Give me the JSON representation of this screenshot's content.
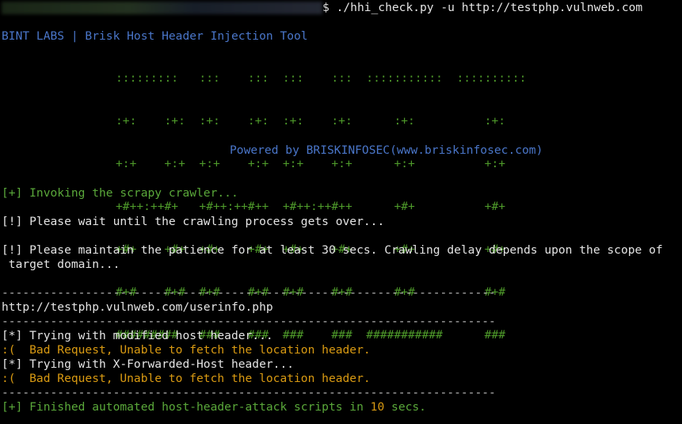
{
  "prompt": {
    "suffix": "$",
    "command": " ./hhi_check.py -u http://testphp.vulnweb.com"
  },
  "banner": {
    "title": "BINT LABS | Brisk Host Header Injection Tool",
    "ascii_art": [
      ":::::::::   :::    :::  :::    :::  :::::::::::  ::::::::::",
      ":+:    :+:  :+:    :+:  :+:    :+:      :+:          :+:",
      "+:+    +:+  +:+    +:+  +:+    +:+      +:+          +:+",
      "+#++:++#+   +#++:++#++  +#++:++#++      +#+          +#+",
      "+#+    +#+  +#+    +#+  +#+    +#+      +#+          +#+",
      "#+#    #+#  #+#    #+#  #+#    #+#      #+#          #+#",
      "#########   ###    ###  ###    ###  ###########      ###"
    ],
    "powered_by": "Powered by BRISKINFOSEC(www.briskinfosec.com)"
  },
  "output": {
    "invoking": "[+] Invoking the scrapy crawler...",
    "wait": "[!] Please wait until the crawling process gets over...",
    "patience_1": "[!] Please maintain the patience for at least 30 secs. Crawling delay depends upon the scope of",
    "patience_2": " target domain...",
    "separator": "-----------------------------------------------------------------------",
    "url": "http://testphp.vulnweb.com/userinfo.php",
    "try_host": "[*] Trying with modified host header...",
    "bad_request_1": ":(  Bad Request, Unable to fetch the location header.",
    "try_forwarded": "[*] Trying with X-Forwarded-Host header...",
    "bad_request_2": ":(  Bad Request, Unable to fetch the location header.",
    "finished_prefix": "[+] Finished automated host-header-attack scripts in ",
    "finished_secs": "10",
    "finished_suffix": " secs."
  },
  "colors": {
    "background": "#000000",
    "text": "#e4e4e4",
    "blue": "#4a76c9",
    "green": "#5aa83a",
    "orange": "#d99a12"
  }
}
